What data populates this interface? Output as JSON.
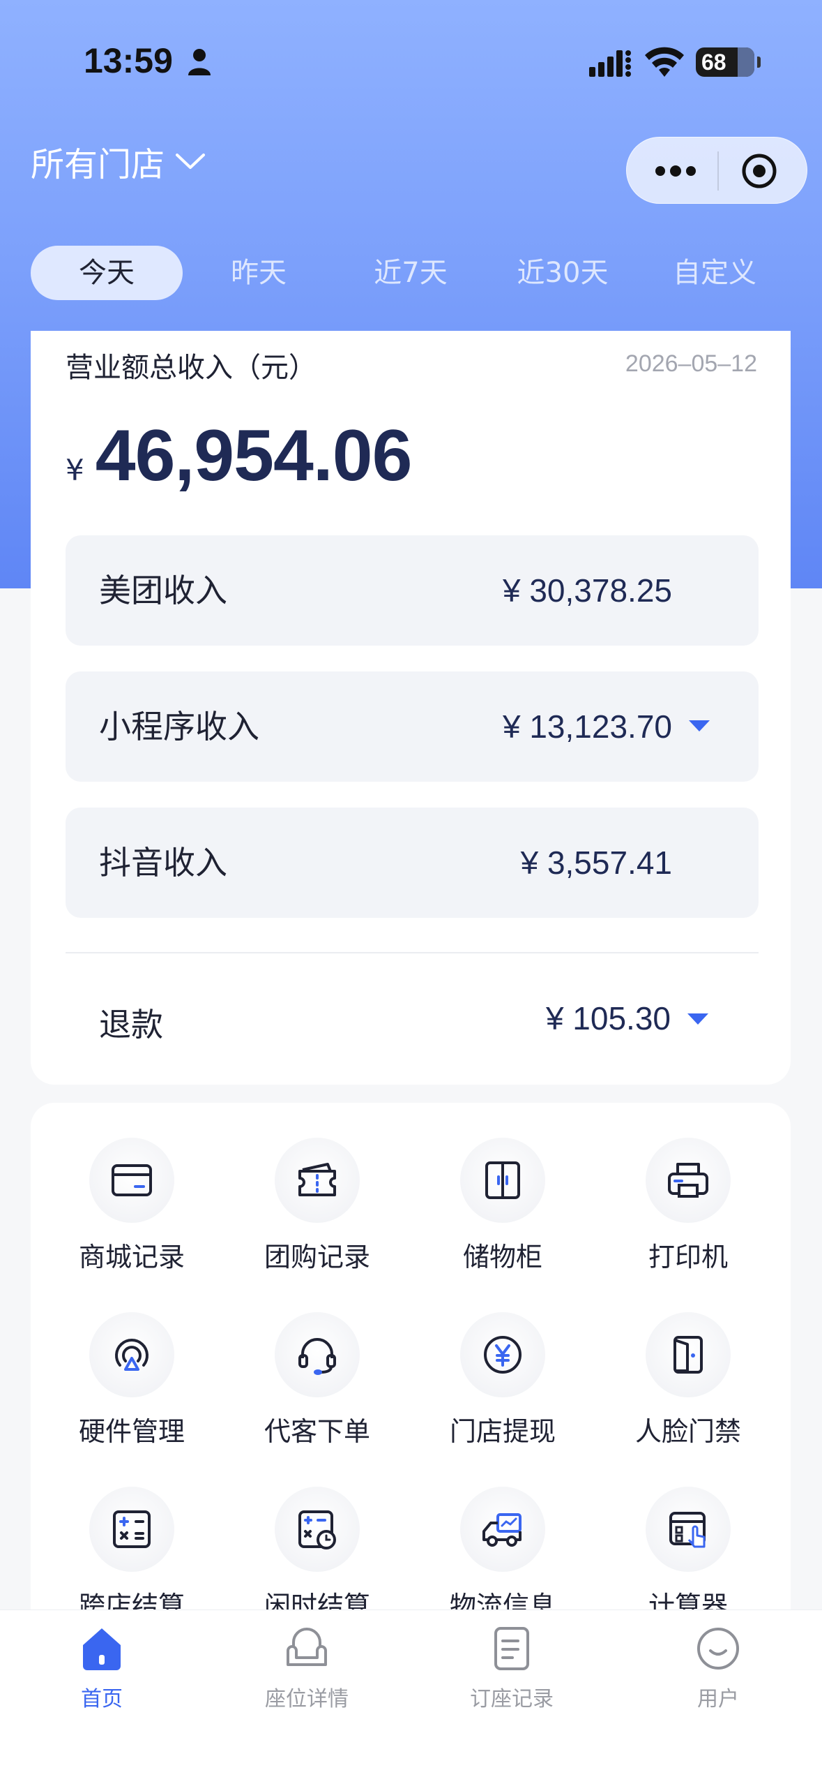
{
  "status_bar": {
    "time": "13:59",
    "battery": "68"
  },
  "header": {
    "store_selector": "所有门店"
  },
  "date_tabs": [
    {
      "label": "今天",
      "active": true
    },
    {
      "label": "昨天",
      "active": false
    },
    {
      "label": "近7天",
      "active": false
    },
    {
      "label": "近30天",
      "active": false
    },
    {
      "label": "自定义",
      "active": false
    }
  ],
  "revenue": {
    "title": "营业额总收入（元）",
    "date": "2026–05–12",
    "currency": "¥",
    "total": "46,954.06",
    "rows": [
      {
        "label": "美团收入",
        "value": "¥ 30,378.25",
        "expandable": false
      },
      {
        "label": "小程序收入",
        "value": "¥ 13,123.70",
        "expandable": true
      },
      {
        "label": "抖音收入",
        "value": "¥ 3,557.41",
        "expandable": false
      }
    ],
    "refund": {
      "label": "退款",
      "value": "¥ 105.30"
    }
  },
  "features": [
    {
      "label": "商城记录",
      "icon": "card-icon"
    },
    {
      "label": "团购记录",
      "icon": "ticket-icon"
    },
    {
      "label": "储物柜",
      "icon": "locker-icon"
    },
    {
      "label": "打印机",
      "icon": "printer-icon"
    },
    {
      "label": "硬件管理",
      "icon": "device-icon"
    },
    {
      "label": "代客下单",
      "icon": "headset-icon"
    },
    {
      "label": "门店提现",
      "icon": "yen-icon"
    },
    {
      "label": "人脸门禁",
      "icon": "door-icon"
    },
    {
      "label": "跨店结算",
      "icon": "calculator-icon"
    },
    {
      "label": "闲时结算",
      "icon": "clock-calculator-icon"
    },
    {
      "label": "物流信息",
      "icon": "truck-icon"
    },
    {
      "label": "计算器",
      "icon": "touch-calculator-icon"
    }
  ],
  "tabbar": [
    {
      "label": "首页",
      "icon": "home-icon",
      "active": true
    },
    {
      "label": "座位详情",
      "icon": "seat-icon",
      "active": false
    },
    {
      "label": "订座记录",
      "icon": "booking-icon",
      "active": false
    },
    {
      "label": "用户",
      "icon": "user-icon",
      "active": false
    }
  ],
  "colors": {
    "accent": "#3a66f0",
    "hero_top": "#8fb1ff",
    "hero_bottom": "#5f86f5",
    "amount_text": "#1f2a55"
  }
}
